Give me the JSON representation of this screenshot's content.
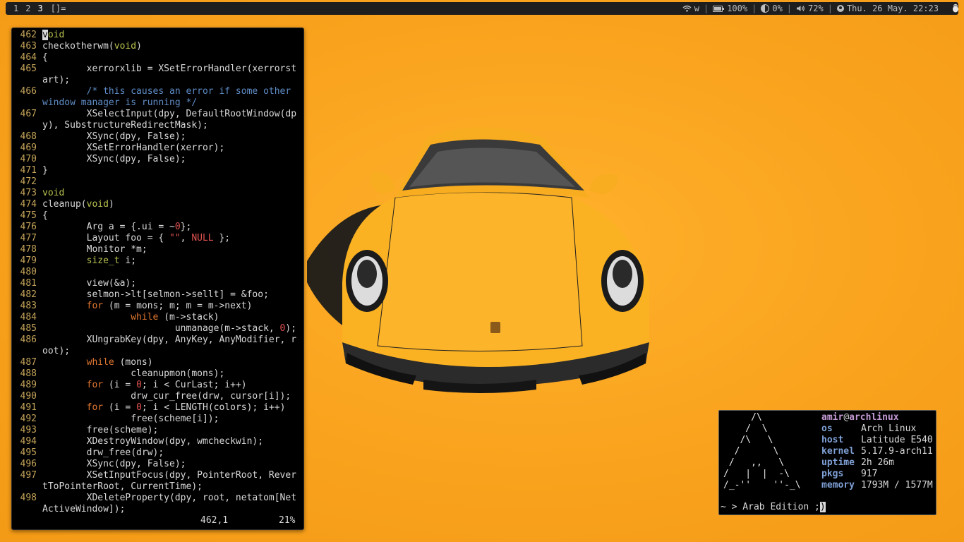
{
  "topbar": {
    "tags": [
      "1",
      "2",
      "3"
    ],
    "active_tag": "3",
    "layout_symbol": "[]=",
    "wifi": "w",
    "battery": "100%",
    "battery_level": 1.0,
    "brightness": "0%",
    "volume": "72%",
    "datetime": "Thu. 26 May. 22:23"
  },
  "editor": {
    "lines": [
      {
        "n": "462",
        "src": "void"
      },
      {
        "n": "463",
        "src": "checkotherwm(void)"
      },
      {
        "n": "464",
        "src": "{"
      },
      {
        "n": "465",
        "src": "        xerrorxlib = XSetErrorHandler(xerrorst"
      },
      {
        "n": "",
        "src": "art);"
      },
      {
        "n": "466",
        "src": "        /* this causes an error if some other "
      },
      {
        "n": "",
        "src": "window manager is running */"
      },
      {
        "n": "467",
        "src": "        XSelectInput(dpy, DefaultRootWindow(dp"
      },
      {
        "n": "",
        "src": "y), SubstructureRedirectMask);"
      },
      {
        "n": "468",
        "src": "        XSync(dpy, False);"
      },
      {
        "n": "469",
        "src": "        XSetErrorHandler(xerror);"
      },
      {
        "n": "470",
        "src": "        XSync(dpy, False);"
      },
      {
        "n": "471",
        "src": "}"
      },
      {
        "n": "472",
        "src": ""
      },
      {
        "n": "473",
        "src": "void"
      },
      {
        "n": "474",
        "src": "cleanup(void)"
      },
      {
        "n": "475",
        "src": "{"
      },
      {
        "n": "476",
        "src": "        Arg a = {.ui = ~0};"
      },
      {
        "n": "477",
        "src": "        Layout foo = { \"\", NULL };"
      },
      {
        "n": "478",
        "src": "        Monitor *m;"
      },
      {
        "n": "479",
        "src": "        size_t i;"
      },
      {
        "n": "480",
        "src": ""
      },
      {
        "n": "481",
        "src": "        view(&a);"
      },
      {
        "n": "482",
        "src": "        selmon->lt[selmon->sellt] = &foo;"
      },
      {
        "n": "483",
        "src": "        for (m = mons; m; m = m->next)"
      },
      {
        "n": "484",
        "src": "                while (m->stack)"
      },
      {
        "n": "485",
        "src": "                        unmanage(m->stack, 0);"
      },
      {
        "n": "486",
        "src": "        XUngrabKey(dpy, AnyKey, AnyModifier, r"
      },
      {
        "n": "",
        "src": "oot);"
      },
      {
        "n": "487",
        "src": "        while (mons)"
      },
      {
        "n": "488",
        "src": "                cleanupmon(mons);"
      },
      {
        "n": "489",
        "src": "        for (i = 0; i < CurLast; i++)"
      },
      {
        "n": "490",
        "src": "                drw_cur_free(drw, cursor[i]);"
      },
      {
        "n": "491",
        "src": "        for (i = 0; i < LENGTH(colors); i++)"
      },
      {
        "n": "492",
        "src": "                free(scheme[i]);"
      },
      {
        "n": "493",
        "src": "        free(scheme);"
      },
      {
        "n": "494",
        "src": "        XDestroyWindow(dpy, wmcheckwin);"
      },
      {
        "n": "495",
        "src": "        drw_free(drw);"
      },
      {
        "n": "496",
        "src": "        XSync(dpy, False);"
      },
      {
        "n": "497",
        "src": "        XSetInputFocus(dpy, PointerRoot, Rever"
      },
      {
        "n": "",
        "src": "tToPointerRoot, CurrentTime);"
      },
      {
        "n": "498",
        "src": "        XDeleteProperty(dpy, root, netatom[Net"
      },
      {
        "n": "",
        "src": "ActiveWindow]);"
      }
    ],
    "cursor_pos": "462,1",
    "scroll_pct": "21%"
  },
  "terminal": {
    "logo": [
      "     /\\",
      "    /  \\",
      "   /\\   \\",
      "  /      \\",
      " /   ,,   \\",
      "/   |  |  -\\",
      "/_-''    ''-_\\"
    ],
    "user": "amir",
    "at": "@",
    "host": "archlinux",
    "info": [
      {
        "k": "os",
        "v": "Arch Linux"
      },
      {
        "k": "host",
        "v": "Latitude E540"
      },
      {
        "k": "kernel",
        "v": "5.17.9-arch11"
      },
      {
        "k": "uptime",
        "v": "2h 26m"
      },
      {
        "k": "pkgs",
        "v": "917"
      },
      {
        "k": "memory",
        "v": "1793M / 1577M"
      }
    ],
    "prompt": "~ > Arab Edition ;",
    "prompt_cursor": ")"
  },
  "colors": {
    "wallpaper": "#f9a21d",
    "bar_bg": "#1e1e1e",
    "keyword": "#b8c24e",
    "control": "#e0762f",
    "comment": "#5f8dc7",
    "line_number": "#c5a45a"
  }
}
